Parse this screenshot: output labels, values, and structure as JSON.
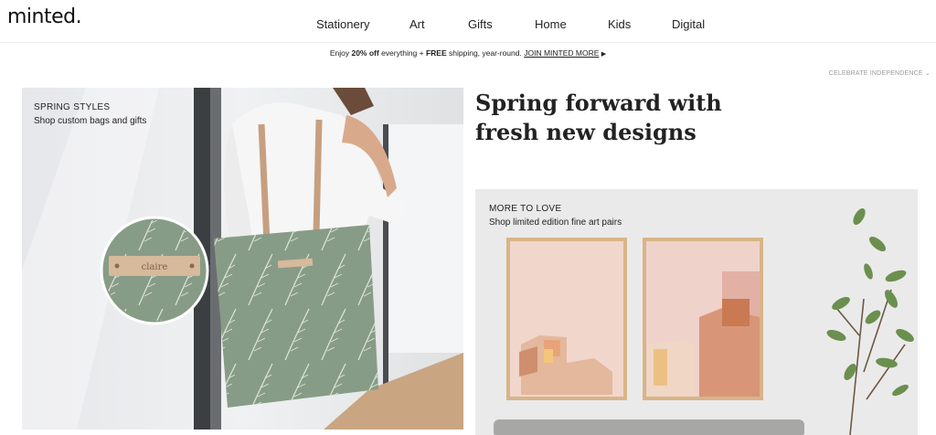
{
  "header": {
    "logo": "minted.",
    "nav": [
      "Stationery",
      "Art",
      "Gifts",
      "Home",
      "Kids",
      "Digital"
    ]
  },
  "promo": {
    "prefix": "Enjoy ",
    "discount": "20% off",
    "middle": " everything + ",
    "free": "FREE",
    "suffix": " shipping, year-round. ",
    "join": "JOIN MINTED MORE",
    "arrow": "▶"
  },
  "holiday_link": "CELEBRATE INDEPENDENCE ⌄",
  "hero_left": {
    "label_title": "SPRING STYLES",
    "label_sub": "Shop custom bags and gifts",
    "tag_text": "claire"
  },
  "headline": {
    "line1": "Spring forward with",
    "line2": "fresh new designs"
  },
  "hero_right": {
    "label_title": "MORE TO LOVE",
    "label_sub": "Shop limited edition fine art pairs"
  },
  "colors": {
    "bag_green": "#879c86",
    "leather": "#d7b99c",
    "frame_wood": "#d8b587",
    "print_pink": "#f1d6cc",
    "plant_green": "#6b8f4e"
  }
}
